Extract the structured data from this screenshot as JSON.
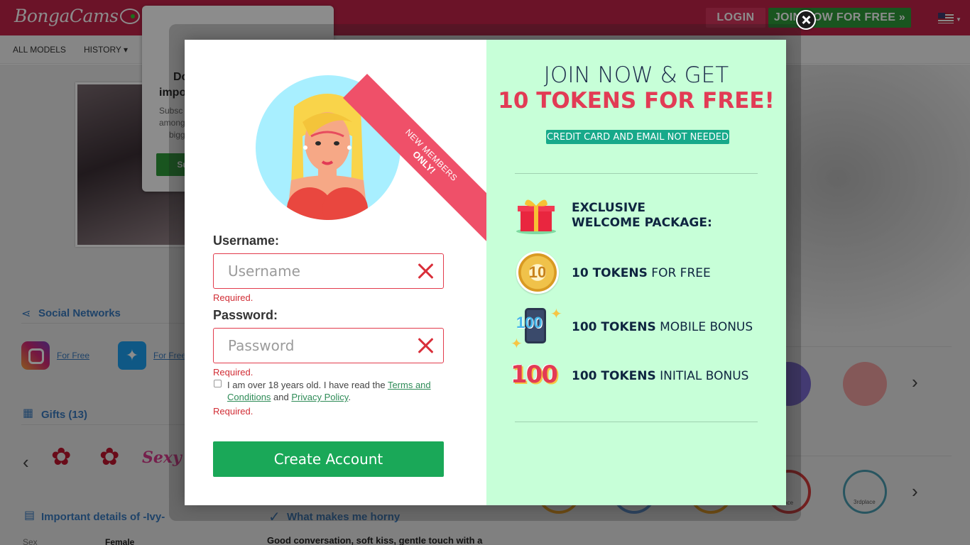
{
  "header": {
    "logo_text": "BongaCams",
    "login_label": "LOGIN",
    "join_label": "JOIN NOW FOR FREE »"
  },
  "nav": {
    "items": [
      {
        "label": "ALL MODELS"
      },
      {
        "label": "HISTORY ▾"
      }
    ]
  },
  "background_popup": {
    "title_line1": "Do",
    "title_line2": "impo",
    "text_line1": "Subsc",
    "text_line2": "among",
    "text_line3": "bigg",
    "button_label": "Sub"
  },
  "profile": {
    "social_title": "Social Networks",
    "social_links": [
      {
        "label": "For Free"
      },
      {
        "label": "For Free"
      }
    ],
    "gifts_title": "Gifts (13)",
    "gift_sexy": "Sexy",
    "details_title": "Important details of -Ivy-",
    "details_sex_label": "Sex",
    "details_sex_value": "Female",
    "horny_title": "What makes me horny",
    "horny_text": "Good conversation, soft kiss, gentle touch with a",
    "badge_text_1": "place",
    "badge_text_2": "3rdplace"
  },
  "modal": {
    "ribbon_line1": "NEW MEMBERS",
    "ribbon_line2": "ONLY!",
    "username_label": "Username:",
    "username_placeholder": "Username",
    "username_error": "Required.",
    "password_label": "Password:",
    "password_placeholder": "Password",
    "password_error": "Required.",
    "terms_prefix": "I am over 18 years old. I have read the ",
    "terms_link": "Terms and Conditions",
    "terms_and": " and ",
    "privacy_link": "Privacy Policy",
    "terms_suffix": ".",
    "terms_error": "Required.",
    "create_label": "Create Account",
    "right": {
      "title_line1": "JOIN NOW & GET",
      "title_line2": "10 TOKENS FOR FREE!",
      "badge": "CREDIT CARD AND EMAIL NOT NEEDED",
      "features": [
        {
          "bold": "EXCLUSIVE",
          "bold2": "WELCOME PACKAGE:",
          "icon": "gift-icon"
        },
        {
          "bold": "10 TOKENS",
          "rest": " FOR FREE",
          "icon": "coin-icon",
          "coin_text": "10"
        },
        {
          "bold": "100 TOKENS",
          "rest": " MOBILE BONUS",
          "icon": "mobile-bonus-icon",
          "icon_text": "100"
        },
        {
          "bold": "100 TOKENS",
          "rest": " INITIAL BONUS",
          "icon": "initial-bonus-icon",
          "icon_text": "100"
        }
      ]
    }
  },
  "colors": {
    "topbar": "#c4234a",
    "right_panel": "#c7ffd8",
    "accent_red": "#e23b55",
    "create_button": "#1aa858",
    "badge": "#17a98a"
  }
}
